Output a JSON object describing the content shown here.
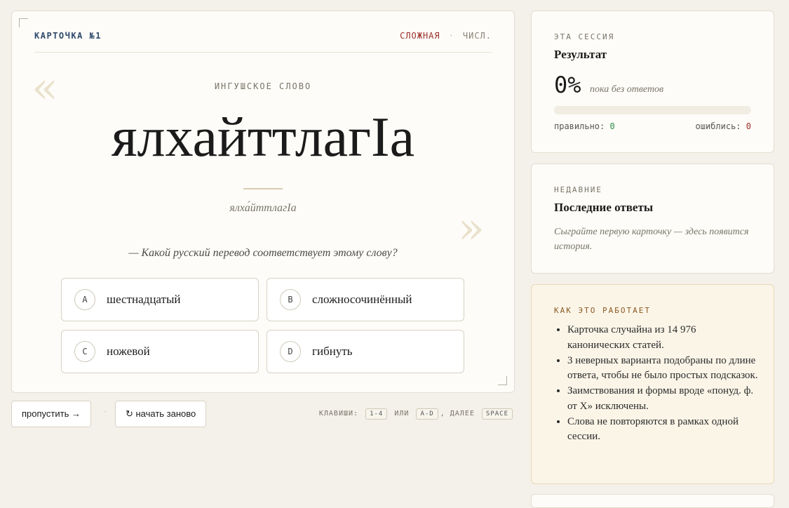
{
  "card": {
    "number": "КАРТОЧКА №1",
    "difficulty": "СЛОЖНАЯ",
    "separator": "·",
    "pos": "ЧИСЛ.",
    "quote_open": "«",
    "quote_close": "»",
    "word_label": "ИНГУШСКОЕ СЛОВО",
    "word": "ялхайттлагӀа",
    "transliteration": "ялха́йттлагIа",
    "question": "— Какой русский перевод соответствует этому слову?",
    "options": [
      {
        "letter": "A",
        "text": "шестнадцатый"
      },
      {
        "letter": "B",
        "text": "сложносочинённый"
      },
      {
        "letter": "C",
        "text": "ножевой"
      },
      {
        "letter": "D",
        "text": "гибнуть"
      }
    ]
  },
  "controls": {
    "skip_label": "пропустить →",
    "separator": "·",
    "restart_label": "↻ начать заново",
    "keys_prefix": "КЛАВИШИ:",
    "key_nums": "1-4",
    "keys_or": "ИЛИ",
    "key_letters": "A-D",
    "keys_then": ", ДАЛЕЕ",
    "key_space": "SPACE"
  },
  "session": {
    "label": "ЭТА СЕССИЯ",
    "title": "Результат",
    "percent": "0%",
    "percent_note": "пока без ответов",
    "progress_fraction": 0,
    "correct_label": "правильно:",
    "correct_value": "0",
    "wrong_label": "ошиблись:",
    "wrong_value": "0"
  },
  "recent": {
    "label": "НЕДАВНИЕ",
    "title": "Последние ответы",
    "note": "Сыграйте первую карточку — здесь появится история."
  },
  "how": {
    "label": "КАК ЭТО РАБОТАЕТ",
    "items": [
      "Карточка случайна из 14 976 канонических статей.",
      "3 неверных варианта подобраны по длине ответа, чтобы не было простых подсказок.",
      "Заимствования и формы вроде «понуд. ф. от X» исключены.",
      "Слова не повторяются в рамках одной сессии."
    ]
  },
  "colors": {
    "accent_blue": "#2f4a6b",
    "difficulty_red": "#9c2f2a",
    "correct_green": "#2e8a4a",
    "how_accent": "#8a5a22"
  }
}
